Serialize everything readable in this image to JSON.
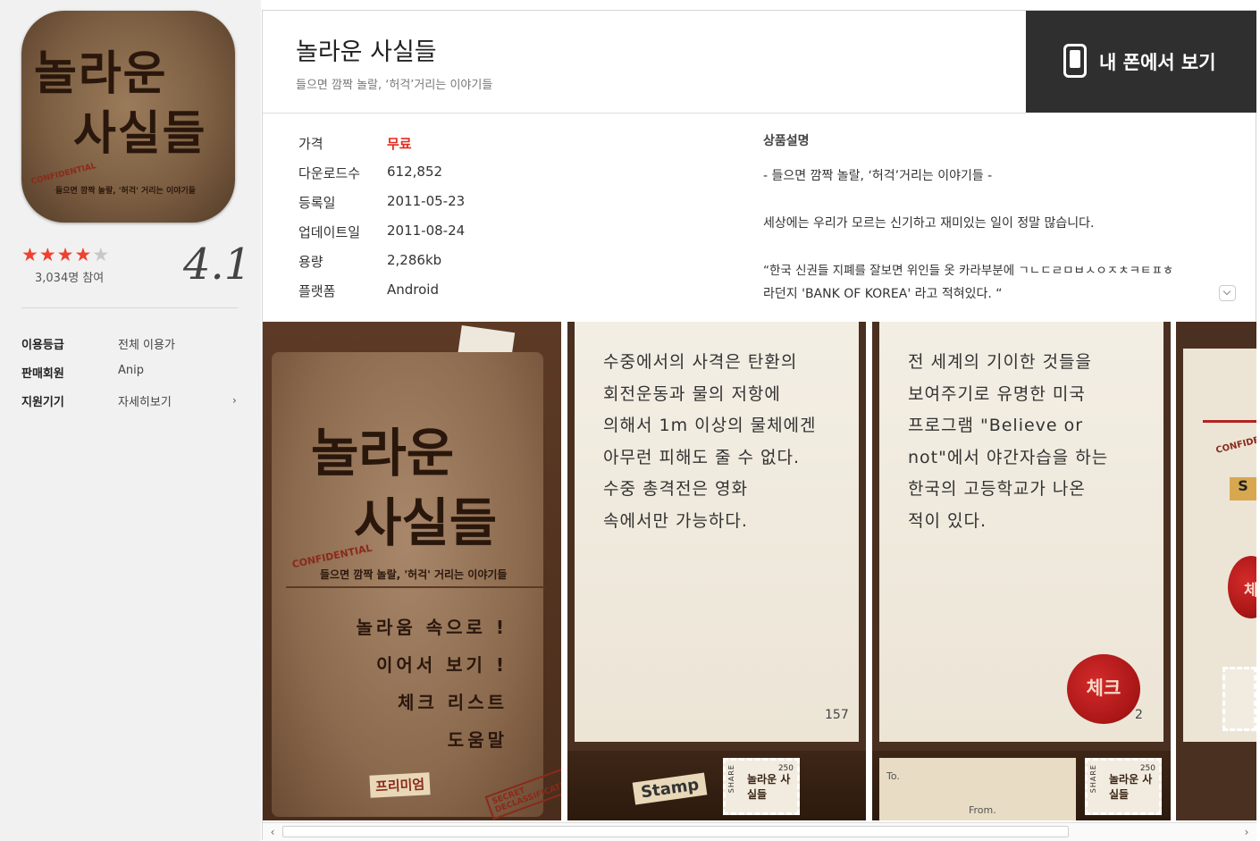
{
  "icon": {
    "title_line1": "놀라운",
    "title_line2": "사실들",
    "confidential": "CONFIDENTIAL",
    "subtitle": "들으면 깜짝 놀랄, '허걱' 거리는 이야기들"
  },
  "rating": {
    "stars": 4,
    "max_stars": 5,
    "count_text": "3,034명 참여",
    "score": "4.1"
  },
  "info": [
    {
      "label": "이용등급",
      "value": "전체 이용가"
    },
    {
      "label": "판매회원",
      "value": "Anip"
    },
    {
      "label": "지원기기",
      "value": "자세히보기"
    }
  ],
  "header": {
    "title": "놀라운 사실들",
    "subtitle": "들으면 깜짝 놀랄, ‘허걱’거리는 이야기들",
    "phone_button": "내 폰에서 보기"
  },
  "details": [
    {
      "label": "가격",
      "value": "무료"
    },
    {
      "label": "다운로드수",
      "value": "612,852"
    },
    {
      "label": "등록일",
      "value": "2011-05-23"
    },
    {
      "label": "업데이트일",
      "value": "2011-08-24"
    },
    {
      "label": "용량",
      "value": "2,286kb"
    },
    {
      "label": "플랫폼",
      "value": "Android"
    }
  ],
  "description": {
    "title": "상품설명",
    "lines": [
      "- 들으면 깜짝 놀랄, ‘허걱’거리는 이야기들 -",
      "세상에는 우리가 모르는 신기하고 재미있는 일이 정말 많습니다.",
      "“한국 신권들 지폐를 잘보면 위인들 옷 카라부분에 ㄱㄴㄷㄹㅁㅂㅅㅇㅈㅊㅋㅌㅍㅎ",
      "라던지 'BANK OF KOREA' 라고 적혀있다. “"
    ]
  },
  "screenshots": {
    "shot1": {
      "title_line1": "놀라운",
      "title_line2": "사실들",
      "confidential": "CONFIDENTIAL",
      "subtitle": "들으면 깜짝 놀랄, '허걱' 거리는 이야기들",
      "menu": [
        "놀라움 속으로 !",
        "이어서 보기 !",
        "체크 리스트",
        "도움말"
      ],
      "premium": "프리미엄",
      "secret": "SECRET DECLASSIFICATION"
    },
    "shot2": {
      "text": "수중에서의 사격은 탄환의\n회전운동과 물의 저항에\n의해서 1m 이상의 물체에겐\n아무런 피해도 줄 수 없다.\n수중 총격전은 영화\n속에서만 가능하다.",
      "page": "157",
      "stamp_button": "Stamp",
      "stamp_title": "놀라운 사실들",
      "stamp_number": "250",
      "share": "SHARE"
    },
    "shot3": {
      "text": "전 세계의 기이한 것들을\n보여주기로 유명한 미국\n프로그램 \"Believe or\nnot\"에서 야간자습을 하는\n한국의 고등학교가 나온\n적이 있다.",
      "page": "2",
      "seal": "체크",
      "to": "To.",
      "from": "From.",
      "stamp_title": "놀라운 사실들",
      "stamp_number": "250",
      "share": "SHARE"
    },
    "shot4": {
      "confidential": "CONFIDEN",
      "button": "S",
      "seal": "체"
    }
  }
}
